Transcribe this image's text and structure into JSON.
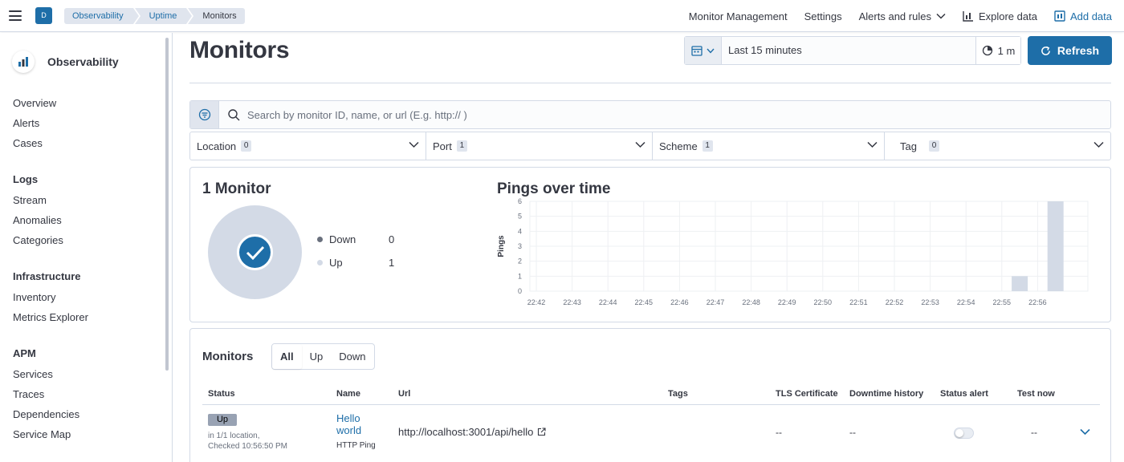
{
  "header": {
    "space_initial": "D",
    "breadcrumbs": [
      "Observability",
      "Uptime",
      "Monitors"
    ],
    "links": {
      "monitor_management": "Monitor Management",
      "settings": "Settings",
      "alerts_rules": "Alerts and rules",
      "explore_data": "Explore data",
      "add_data": "Add data"
    }
  },
  "sidebar": {
    "title": "Observability",
    "items": {
      "overview": "Overview",
      "alerts": "Alerts",
      "cases": "Cases",
      "logs": "Logs",
      "stream": "Stream",
      "anomalies": "Anomalies",
      "categories": "Categories",
      "infrastructure": "Infrastructure",
      "inventory": "Inventory",
      "metrics_explorer": "Metrics Explorer",
      "apm": "APM",
      "services": "Services",
      "traces": "Traces",
      "dependencies": "Dependencies",
      "service_map": "Service Map"
    }
  },
  "page": {
    "title": "Monitors",
    "time_range": "Last 15 minutes",
    "refresh_interval": "1 m",
    "refresh_label": "Refresh"
  },
  "search": {
    "placeholder": "Search by monitor ID, name, or url (E.g. http:// )"
  },
  "filters": {
    "location": {
      "label": "Location",
      "count": "0"
    },
    "port": {
      "label": "Port",
      "count": "1"
    },
    "scheme": {
      "label": "Scheme",
      "count": "1"
    },
    "tag": {
      "label": "Tag",
      "count": "0"
    }
  },
  "summary": {
    "title": "1 Monitor",
    "down_label": "Down",
    "down_count": "0",
    "up_label": "Up",
    "up_count": "1"
  },
  "chart_data": {
    "type": "bar",
    "title": "Pings over time",
    "xlabel": "",
    "ylabel": "Pings",
    "ylim": [
      0,
      6
    ],
    "yticks": [
      "0",
      "1",
      "2",
      "3",
      "4",
      "5",
      "6"
    ],
    "categories": [
      "22:42",
      "22:43",
      "22:44",
      "22:45",
      "22:46",
      "22:47",
      "22:48",
      "22:49",
      "22:50",
      "22:51",
      "22:52",
      "22:53",
      "22:54",
      "22:55",
      "22:56"
    ],
    "bars": [
      {
        "x": "22:55:30",
        "value": 1
      },
      {
        "x": "22:56:30",
        "value": 6
      }
    ],
    "grid": true,
    "bar_color": "#d3dae6"
  },
  "monitors_table": {
    "title": "Monitors",
    "tabs": [
      "All",
      "Up",
      "Down"
    ],
    "columns": [
      "Status",
      "Name",
      "Url",
      "Tags",
      "TLS Certificate",
      "Downtime history",
      "Status alert",
      "Test now"
    ],
    "rows": [
      {
        "status": "Up",
        "location": "in 1/1 location,",
        "checked": "Checked 10:56:50 PM",
        "name": "Hello world",
        "type": "HTTP Ping",
        "url": "http://localhost:3001/api/hello",
        "tls": "--",
        "downtime": "--",
        "test_now": "--"
      }
    ]
  },
  "colors": {
    "accent": "#1e6ea8",
    "up": "#d3dae6",
    "down": "#69707d"
  }
}
